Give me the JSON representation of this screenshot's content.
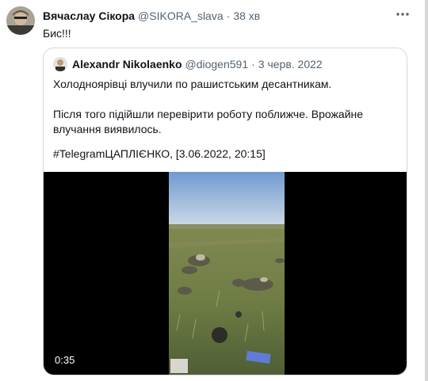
{
  "tweet": {
    "author_name": "Вячаслау Сікора",
    "author_handle": "@SIKORA_slava",
    "separator": "·",
    "time": "38 хв",
    "text": "Бис!!!",
    "more_icon": "more-horizontal-icon"
  },
  "quoted": {
    "author_name": "Alexandr Nikolaenko",
    "author_handle": "@diogen591",
    "separator": "·",
    "date": "3 черв. 2022",
    "lines": [
      "Холодноярівці влучили по рашистським десантникам.",
      "Після того підійшли перевірити роботу поближче. Врожайне",
      "влучання виявилось.",
      "#TelegramЦАПЛІЄНКО, [3.06.2022, 20:15]"
    ],
    "video": {
      "duration": "0:35"
    }
  },
  "colors": {
    "text_primary": "#0f1419",
    "text_secondary": "#536471",
    "border": "#cfd9de",
    "video_bg": "#000000"
  }
}
